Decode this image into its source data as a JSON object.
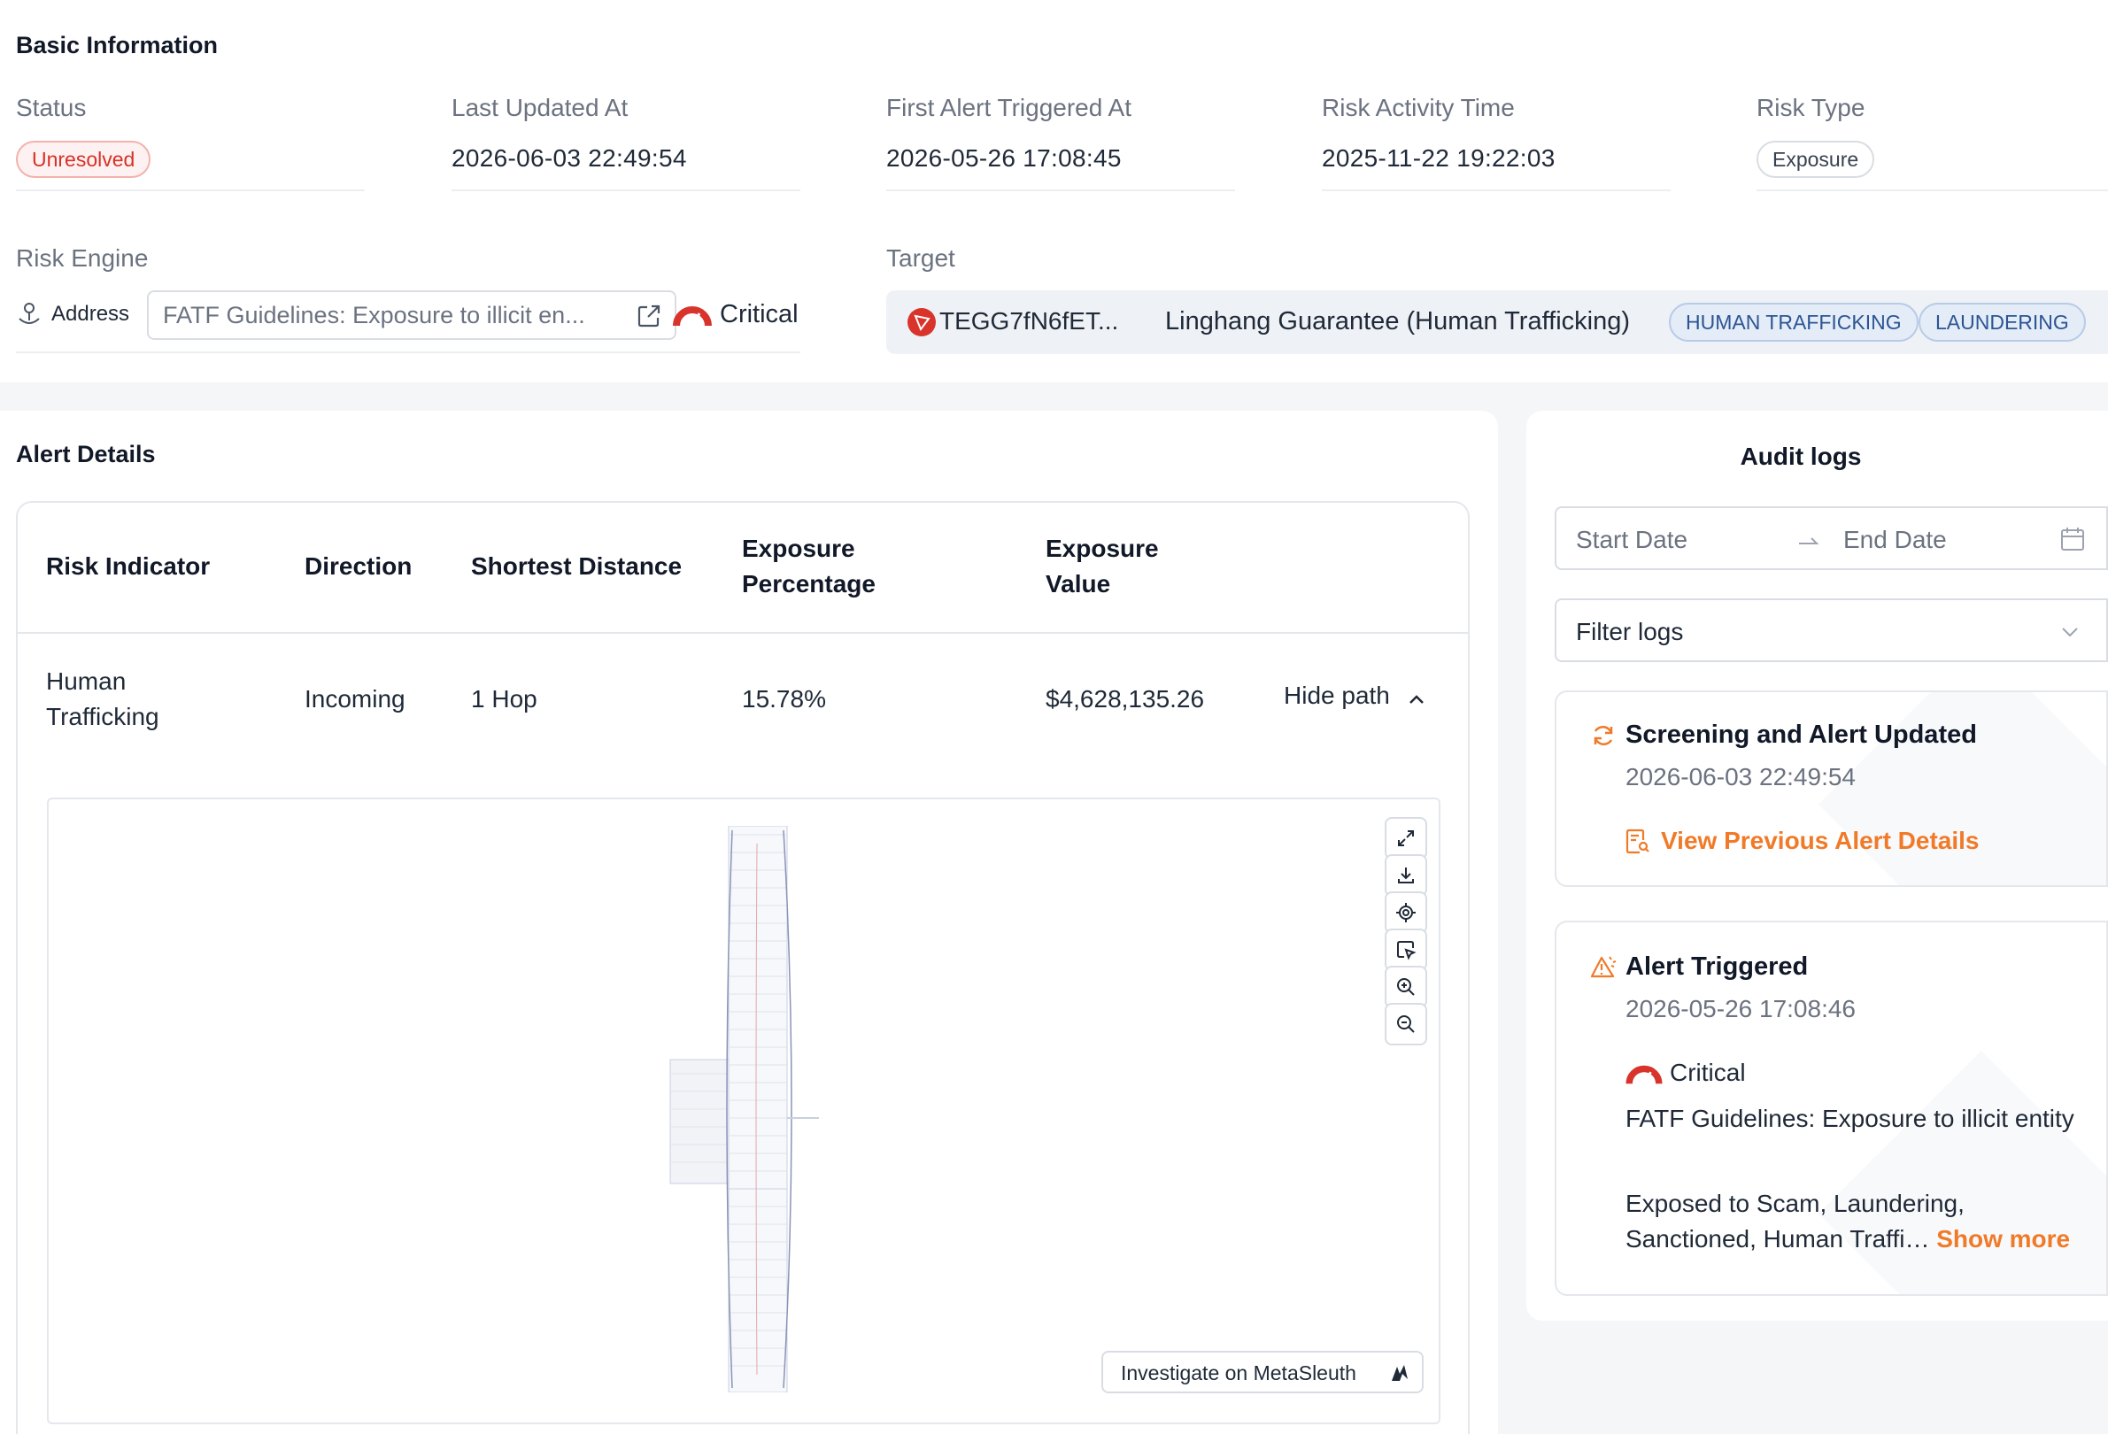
{
  "basic": {
    "title": "Basic Information",
    "fields": {
      "status_label": "Status",
      "status_value": "Unresolved",
      "last_updated_label": "Last Updated At",
      "last_updated_value": "2026-06-03 22:49:54",
      "first_alert_label": "First Alert Triggered At",
      "first_alert_value": "2026-05-26 17:08:45",
      "risk_activity_label": "Risk Activity Time",
      "risk_activity_value": "2025-11-22 19:22:03",
      "risk_type_label": "Risk Type",
      "risk_type_value": "Exposure"
    },
    "risk_engine": {
      "label": "Risk Engine",
      "type_label": "Address",
      "rule": "FATF Guidelines: Exposure to illicit en...",
      "severity": "Critical"
    },
    "target": {
      "label": "Target",
      "address": "TEGG7fN6fET...",
      "name": "Linghang Guarantee (Human Trafficking)",
      "tags": [
        "HUMAN TRAFFICKING",
        "LAUNDERING"
      ]
    }
  },
  "alert": {
    "title": "Alert Details",
    "columns": {
      "risk_indicator": "Risk Indicator",
      "direction": "Direction",
      "shortest_distance": "Shortest Distance",
      "exposure_percentage_1": "Exposure",
      "exposure_percentage_2": "Percentage",
      "exposure_value_1": "Exposure",
      "exposure_value_2": "Value"
    },
    "row": {
      "risk_indicator_1": "Human",
      "risk_indicator_2": "Trafficking",
      "direction": "Incoming",
      "shortest_distance": "1 Hop",
      "exposure_percentage": "15.78%",
      "exposure_value": "$4,628,135.26",
      "toggle": "Hide path"
    },
    "graph": {
      "tools": [
        "expand-icon",
        "download-icon",
        "locate-icon",
        "select-icon",
        "zoom-in-icon",
        "zoom-out-icon"
      ],
      "investigate_label": "Investigate on MetaSleuth"
    }
  },
  "audit": {
    "title": "Audit logs",
    "start_placeholder": "Start Date",
    "end_placeholder": "End Date",
    "filter_placeholder": "Filter logs",
    "logs": [
      {
        "title": "Screening and Alert Updated",
        "time": "2026-06-03 22:49:54",
        "link": "View Previous Alert Details"
      },
      {
        "title": "Alert Triggered",
        "time": "2026-05-26 17:08:46",
        "severity": "Critical",
        "rule": "FATF Guidelines: Exposure to illicit entity",
        "detail": "Exposed to Scam, Laundering, Sanctioned, Human Traffi…",
        "show_more": "Show more"
      }
    ]
  },
  "colors": {
    "accent_orange": "#f07a28",
    "critical_red": "#d9342b",
    "tag_blue": "#2c5594"
  }
}
